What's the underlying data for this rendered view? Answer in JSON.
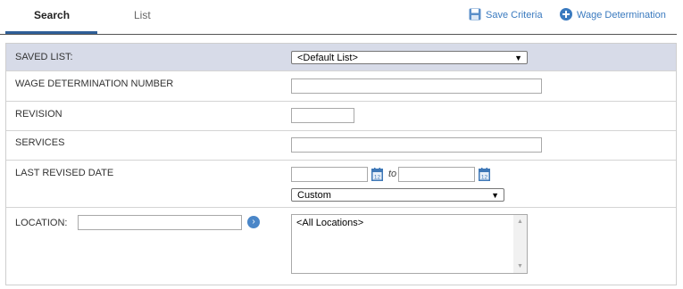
{
  "tabs": {
    "search": "Search",
    "list": "List"
  },
  "actions": {
    "save_criteria": "Save Criteria",
    "wage_determination": "Wage Determination"
  },
  "colors": {
    "accent": "#3a7abf",
    "header_row_bg": "#d7dbe8",
    "tab_underline": "#2f5f98"
  },
  "form": {
    "saved_list": {
      "label": "SAVED LIST:",
      "value": "<Default List>"
    },
    "wd_number": {
      "label": "WAGE DETERMINATION NUMBER",
      "value": ""
    },
    "revision": {
      "label": "REVISION",
      "value": ""
    },
    "services": {
      "label": "SERVICES",
      "value": ""
    },
    "last_revised": {
      "label": "LAST REVISED DATE",
      "to_label": "to",
      "from_value": "",
      "to_value": "",
      "range_value": "Custom",
      "calendar_day": "12"
    },
    "location": {
      "label": "LOCATION:",
      "search_value": "",
      "list_items": [
        "<All Locations>"
      ]
    }
  }
}
